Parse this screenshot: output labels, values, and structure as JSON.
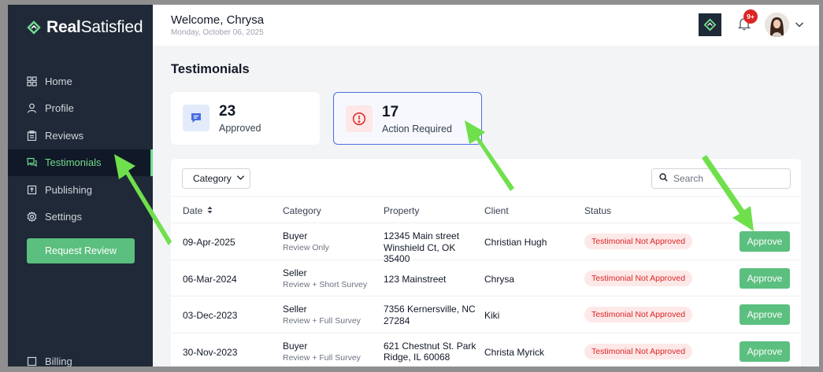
{
  "brand": {
    "name_bold": "Real",
    "name_light": "Satisfied"
  },
  "sidebar": {
    "items": [
      {
        "label": "Home",
        "icon": "grid-icon"
      },
      {
        "label": "Profile",
        "icon": "user-icon"
      },
      {
        "label": "Reviews",
        "icon": "clipboard-icon"
      },
      {
        "label": "Testimonials",
        "icon": "chat-icon",
        "active": true
      },
      {
        "label": "Publishing",
        "icon": "upload-icon"
      },
      {
        "label": "Settings",
        "icon": "gear-icon"
      }
    ],
    "request_review": "Request Review",
    "billing": "Billing"
  },
  "header": {
    "welcome": "Welcome, Chrysa",
    "date": "Monday, October 06, 2025",
    "notification_count": "9+"
  },
  "main": {
    "title": "Testimonials",
    "stats": [
      {
        "value": "23",
        "label": "Approved"
      },
      {
        "value": "17",
        "label": "Action Required"
      }
    ],
    "category_filter": "Category",
    "search_placeholder": "Search",
    "columns": [
      "Date",
      "Category",
      "Property",
      "Client",
      "Status"
    ],
    "rows": [
      {
        "date": "09-Apr-2025",
        "category": "Buyer",
        "category_sub": "Review Only",
        "property": "12345 Main street Winshield Ct, OK 35400",
        "client": "Christian Hugh",
        "status": "Testimonial Not Approved",
        "action": "Approve"
      },
      {
        "date": "06-Mar-2024",
        "category": "Seller",
        "category_sub": "Review + Short Survey",
        "property": "123 Mainstreet",
        "client": "Chrysa",
        "status": "Testimonial Not Approved",
        "action": "Approve"
      },
      {
        "date": "03-Dec-2023",
        "category": "Seller",
        "category_sub": "Review + Full Survey",
        "property": "7356 Kernersville, NC 27284",
        "client": "Kiki",
        "status": "Testimonial Not Approved",
        "action": "Approve"
      },
      {
        "date": "30-Nov-2023",
        "category": "Buyer",
        "category_sub": "Review + Full Survey",
        "property": "621 Chestnut St. Park Ridge, IL 60068",
        "client": "Christa Myrick",
        "status": "Testimonial Not Approved",
        "action": "Approve"
      }
    ]
  },
  "colors": {
    "accent": "#5bbf7f",
    "sidebar": "#1f2937",
    "status_red": "#dc2626",
    "highlight_border": "#4a6ee0"
  }
}
